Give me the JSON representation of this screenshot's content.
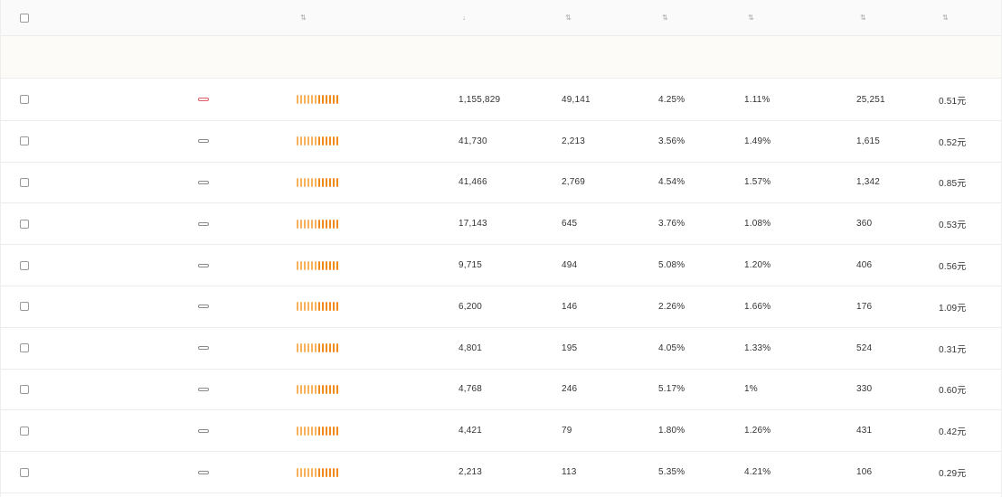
{
  "header": {
    "keyword_label": "",
    "tag_label": "",
    "heat_label": "",
    "col1_label": "",
    "col2_label": "",
    "col3_label": "",
    "col4_label": "",
    "col5_label": "",
    "col6_label": ""
  },
  "group_label": "",
  "icons": {
    "checkbox": "checkbox-icon",
    "sort": "sort-icon"
  },
  "colors": {
    "tag_hot": "#e0616b",
    "heat_bar": "#f08a1a",
    "heat_bar_light": "#f7b15c"
  },
  "rows": [
    {
      "keyword": "",
      "tag": "",
      "tag_type": "hot",
      "heat_level": 1.0,
      "v1": "1,155,829",
      "v2": "49,141",
      "v3": "4.25%",
      "v4": "1.11%",
      "v5": "25,251",
      "v6": "0.51元"
    },
    {
      "keyword": "",
      "tag": "",
      "tag_type": "normal",
      "heat_level": 1.0,
      "v1": "41,730",
      "v2": "2,213",
      "v3": "3.56%",
      "v4": "1.49%",
      "v5": "1,615",
      "v6": "0.52元"
    },
    {
      "keyword": "",
      "tag": "",
      "tag_type": "normal",
      "heat_level": 1.0,
      "v1": "41,466",
      "v2": "2,769",
      "v3": "4.54%",
      "v4": "1.57%",
      "v5": "1,342",
      "v6": "0.85元"
    },
    {
      "keyword": "",
      "tag": "",
      "tag_type": "normal",
      "heat_level": 1.0,
      "v1": "17,143",
      "v2": "645",
      "v3": "3.76%",
      "v4": "1.08%",
      "v5": "360",
      "v6": "0.53元"
    },
    {
      "keyword": "",
      "tag": "",
      "tag_type": "normal",
      "heat_level": 1.0,
      "v1": "9,715",
      "v2": "494",
      "v3": "5.08%",
      "v4": "1.20%",
      "v5": "406",
      "v6": "0.56元"
    },
    {
      "keyword": "",
      "tag": "",
      "tag_type": "normal",
      "heat_level": 1.0,
      "v1": "6,200",
      "v2": "146",
      "v3": "2.26%",
      "v4": "1.66%",
      "v5": "176",
      "v6": "1.09元"
    },
    {
      "keyword": "",
      "tag": "",
      "tag_type": "normal",
      "heat_level": 1.0,
      "v1": "4,801",
      "v2": "195",
      "v3": "4.05%",
      "v4": "1.33%",
      "v5": "524",
      "v6": "0.31元"
    },
    {
      "keyword": "",
      "tag": "",
      "tag_type": "normal",
      "heat_level": 1.0,
      "v1": "4,768",
      "v2": "246",
      "v3": "5.17%",
      "v4": "1%",
      "v5": "330",
      "v6": "0.60元"
    },
    {
      "keyword": "",
      "tag": "",
      "tag_type": "normal",
      "heat_level": 1.0,
      "v1": "4,421",
      "v2": "79",
      "v3": "1.80%",
      "v4": "1.26%",
      "v5": "431",
      "v6": "0.42元"
    },
    {
      "keyword": "",
      "tag": "",
      "tag_type": "normal",
      "heat_level": 1.0,
      "v1": "2,213",
      "v2": "113",
      "v3": "5.35%",
      "v4": "4.21%",
      "v5": "106",
      "v6": "0.29元"
    }
  ]
}
